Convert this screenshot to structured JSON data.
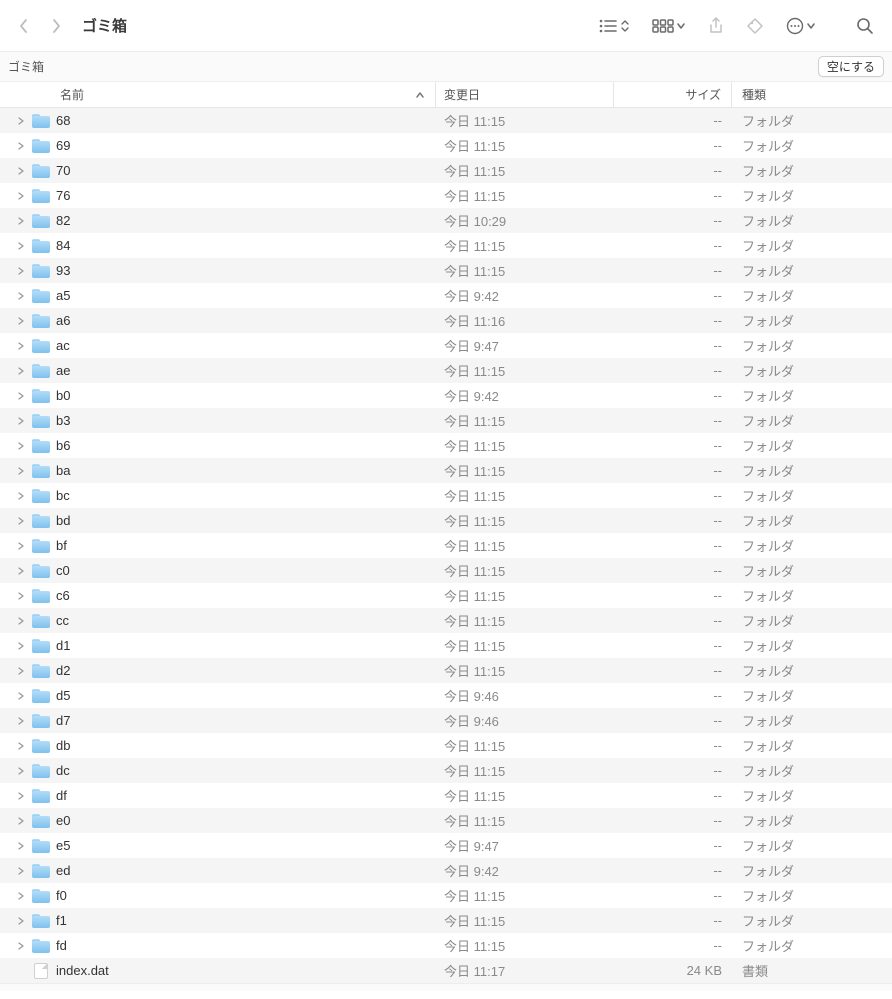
{
  "window": {
    "title": "ゴミ箱"
  },
  "pathbar": {
    "location": "ゴミ箱",
    "empty_button": "空にする"
  },
  "columns": {
    "name": "名前",
    "modified": "変更日",
    "size": "サイズ",
    "kind": "種類"
  },
  "kinds": {
    "folder": "フォルダ",
    "document": "書類"
  },
  "size_placeholder": "--",
  "items": [
    {
      "name": "68",
      "modified": "今日 11:15",
      "size": "--",
      "kind": "folder"
    },
    {
      "name": "69",
      "modified": "今日 11:15",
      "size": "--",
      "kind": "folder"
    },
    {
      "name": "70",
      "modified": "今日 11:15",
      "size": "--",
      "kind": "folder"
    },
    {
      "name": "76",
      "modified": "今日 11:15",
      "size": "--",
      "kind": "folder"
    },
    {
      "name": "82",
      "modified": "今日 10:29",
      "size": "--",
      "kind": "folder"
    },
    {
      "name": "84",
      "modified": "今日 11:15",
      "size": "--",
      "kind": "folder"
    },
    {
      "name": "93",
      "modified": "今日 11:15",
      "size": "--",
      "kind": "folder"
    },
    {
      "name": "a5",
      "modified": "今日 9:42",
      "size": "--",
      "kind": "folder"
    },
    {
      "name": "a6",
      "modified": "今日 11:16",
      "size": "--",
      "kind": "folder"
    },
    {
      "name": "ac",
      "modified": "今日 9:47",
      "size": "--",
      "kind": "folder"
    },
    {
      "name": "ae",
      "modified": "今日 11:15",
      "size": "--",
      "kind": "folder"
    },
    {
      "name": "b0",
      "modified": "今日 9:42",
      "size": "--",
      "kind": "folder"
    },
    {
      "name": "b3",
      "modified": "今日 11:15",
      "size": "--",
      "kind": "folder"
    },
    {
      "name": "b6",
      "modified": "今日 11:15",
      "size": "--",
      "kind": "folder"
    },
    {
      "name": "ba",
      "modified": "今日 11:15",
      "size": "--",
      "kind": "folder"
    },
    {
      "name": "bc",
      "modified": "今日 11:15",
      "size": "--",
      "kind": "folder"
    },
    {
      "name": "bd",
      "modified": "今日 11:15",
      "size": "--",
      "kind": "folder"
    },
    {
      "name": "bf",
      "modified": "今日 11:15",
      "size": "--",
      "kind": "folder"
    },
    {
      "name": "c0",
      "modified": "今日 11:15",
      "size": "--",
      "kind": "folder"
    },
    {
      "name": "c6",
      "modified": "今日 11:15",
      "size": "--",
      "kind": "folder"
    },
    {
      "name": "cc",
      "modified": "今日 11:15",
      "size": "--",
      "kind": "folder"
    },
    {
      "name": "d1",
      "modified": "今日 11:15",
      "size": "--",
      "kind": "folder"
    },
    {
      "name": "d2",
      "modified": "今日 11:15",
      "size": "--",
      "kind": "folder"
    },
    {
      "name": "d5",
      "modified": "今日 9:46",
      "size": "--",
      "kind": "folder"
    },
    {
      "name": "d7",
      "modified": "今日 9:46",
      "size": "--",
      "kind": "folder"
    },
    {
      "name": "db",
      "modified": "今日 11:15",
      "size": "--",
      "kind": "folder"
    },
    {
      "name": "dc",
      "modified": "今日 11:15",
      "size": "--",
      "kind": "folder"
    },
    {
      "name": "df",
      "modified": "今日 11:15",
      "size": "--",
      "kind": "folder"
    },
    {
      "name": "e0",
      "modified": "今日 11:15",
      "size": "--",
      "kind": "folder"
    },
    {
      "name": "e5",
      "modified": "今日 9:47",
      "size": "--",
      "kind": "folder"
    },
    {
      "name": "ed",
      "modified": "今日 9:42",
      "size": "--",
      "kind": "folder"
    },
    {
      "name": "f0",
      "modified": "今日 11:15",
      "size": "--",
      "kind": "folder"
    },
    {
      "name": "f1",
      "modified": "今日 11:15",
      "size": "--",
      "kind": "folder"
    },
    {
      "name": "fd",
      "modified": "今日 11:15",
      "size": "--",
      "kind": "folder"
    },
    {
      "name": "index.dat",
      "modified": "今日 11:17",
      "size": "24 KB",
      "kind": "document"
    }
  ]
}
